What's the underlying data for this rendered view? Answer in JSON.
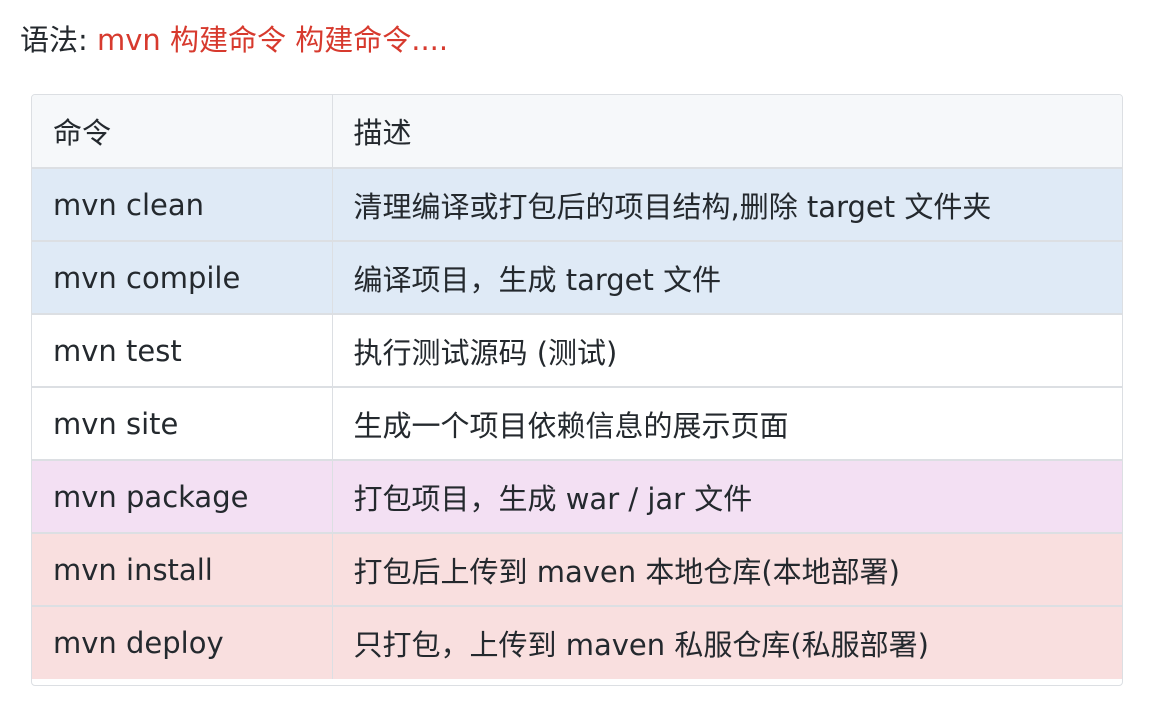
{
  "syntax": {
    "label": "语法:",
    "code": "mvn 构建命令  构建命令...."
  },
  "table": {
    "headers": [
      "命令",
      "描述"
    ],
    "rows": [
      {
        "command": "mvn clean",
        "description": "清理编译或打包后的项目结构,删除 target 文件夹",
        "color": "#dfeaf6"
      },
      {
        "command": "mvn compile",
        "description": "编译项目，生成 target 文件",
        "color": "#dfeaf6"
      },
      {
        "command": "mvn test",
        "description": "执行测试源码 (测试)",
        "color": "#ffffff"
      },
      {
        "command": "mvn site",
        "description": "生成一个项目依赖信息的展示页面",
        "color": "#ffffff"
      },
      {
        "command": "mvn package",
        "description": "打包项目，生成 war / jar 文件",
        "color": "#f3e0f3"
      },
      {
        "command": "mvn install",
        "description": "打包后上传到 maven 本地仓库(本地部署)",
        "color": "#f9dfdf"
      },
      {
        "command": "mvn deploy",
        "description": "只打包，上传到 maven 私服仓库(私服部署)",
        "color": "#f9dfdf"
      }
    ]
  },
  "colors": {
    "code_text": "#d73a2e",
    "header_bg": "#f6f8fa",
    "border": "#dcdfe3"
  }
}
